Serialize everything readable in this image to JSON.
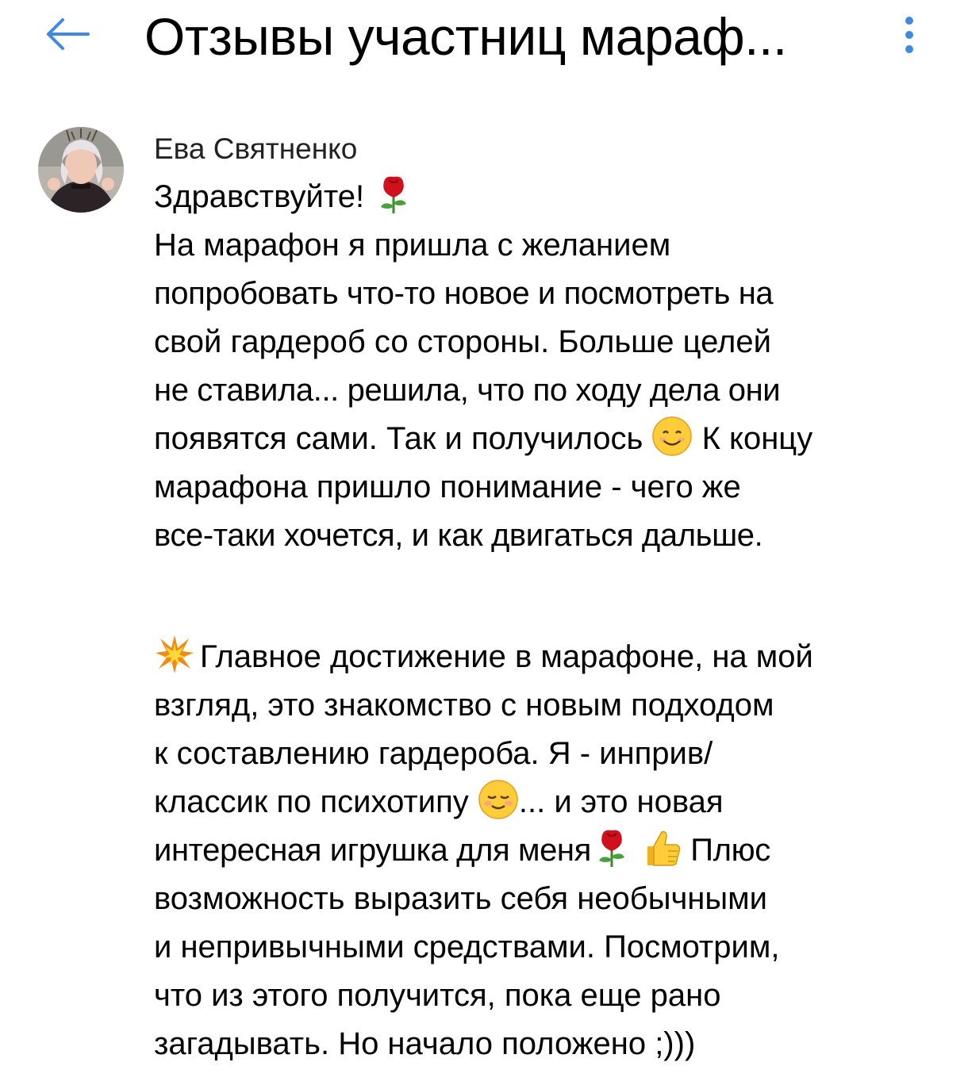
{
  "header": {
    "title": "Отзывы участниц мараф...",
    "back_icon": "arrow-left-icon",
    "more_icon": "more-vertical-icon",
    "accent_color": "#3f8ae0"
  },
  "comment": {
    "author": "Ева Святненко",
    "lines": [
      "Здравствуйте! ",
      "На марафон я пришла с желанием",
      "попробовать что-то новое и посмотреть на",
      "свой гардероб со стороны. Больше целей",
      "не ставила... решила, что по ходу дела они",
      "появятся сами. Так и получилось ",
      " К концу",
      "марафона пришло понимание - чего же",
      "все-таки хочется, и как двигаться дальше.",
      "Главное достижение в марафоне, на мой",
      "взгляд, это знакомство с новым подходом",
      "к составлению гардероба. Я - инприв/",
      "классик по психотипу ",
      "... и это новая",
      "интересная игрушка для меня",
      " Плюс",
      "возможность выразить себя необычными",
      "и непривычными средствами. Посмотрим,",
      "что из этого получится, пока еще рано",
      "загадывать. Но начало положено ;)))"
    ],
    "emoji": [
      "rose-emoji",
      "smiling-face-emoji",
      "collision-emoji",
      "relieved-face-emoji",
      "rose-emoji",
      "thumbs-up-emoji"
    ]
  }
}
